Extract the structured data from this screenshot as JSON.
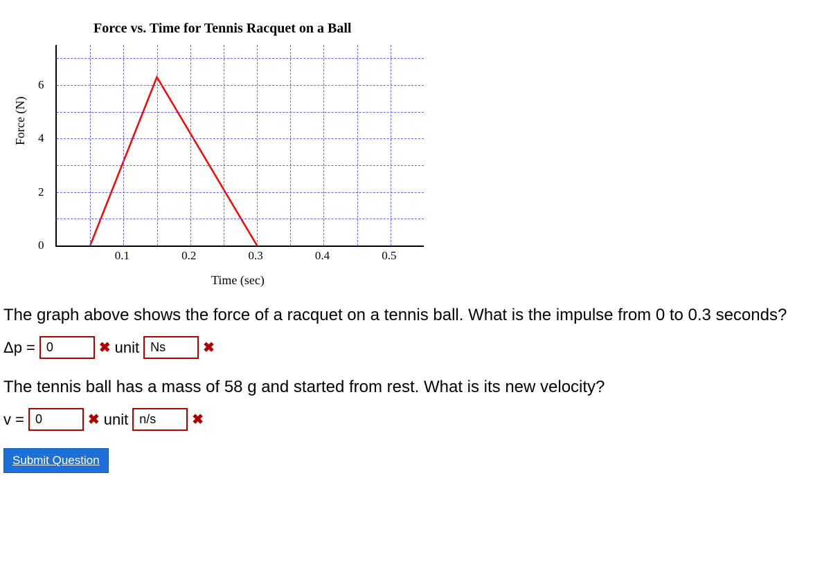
{
  "chart_data": {
    "type": "line",
    "title": "Force vs. Time for Tennis Racquet on a Ball",
    "xlabel": "Time (sec)",
    "ylabel": "Force (N)",
    "x": [
      0.05,
      0.15,
      0.3
    ],
    "y": [
      0,
      6.3,
      0
    ],
    "xlim": [
      0,
      0.55
    ],
    "ylim": [
      0,
      7.5
    ],
    "xticks": [
      0.1,
      0.2,
      0.3,
      0.4,
      0.5
    ],
    "yticks": [
      0,
      2,
      4,
      6
    ],
    "grid": true,
    "series_color": "#ff0000"
  },
  "q1": "The graph above shows the force of a racquet on a tennis ball. What is the impulse from 0 to 0.3 seconds?",
  "ans1": {
    "label": "Δp =",
    "value": "0",
    "mark1": "✖",
    "unit_label": "unit",
    "unit_value": "Ns",
    "mark2": "✖"
  },
  "q2": "The tennis ball has a mass of 58 g and started from rest. What is its new velocity?",
  "ans2": {
    "label": "v =",
    "value": "0",
    "mark1": "✖",
    "unit_label": "unit",
    "unit_value": "n/s",
    "mark2": "✖"
  },
  "submit": "Submit Question"
}
